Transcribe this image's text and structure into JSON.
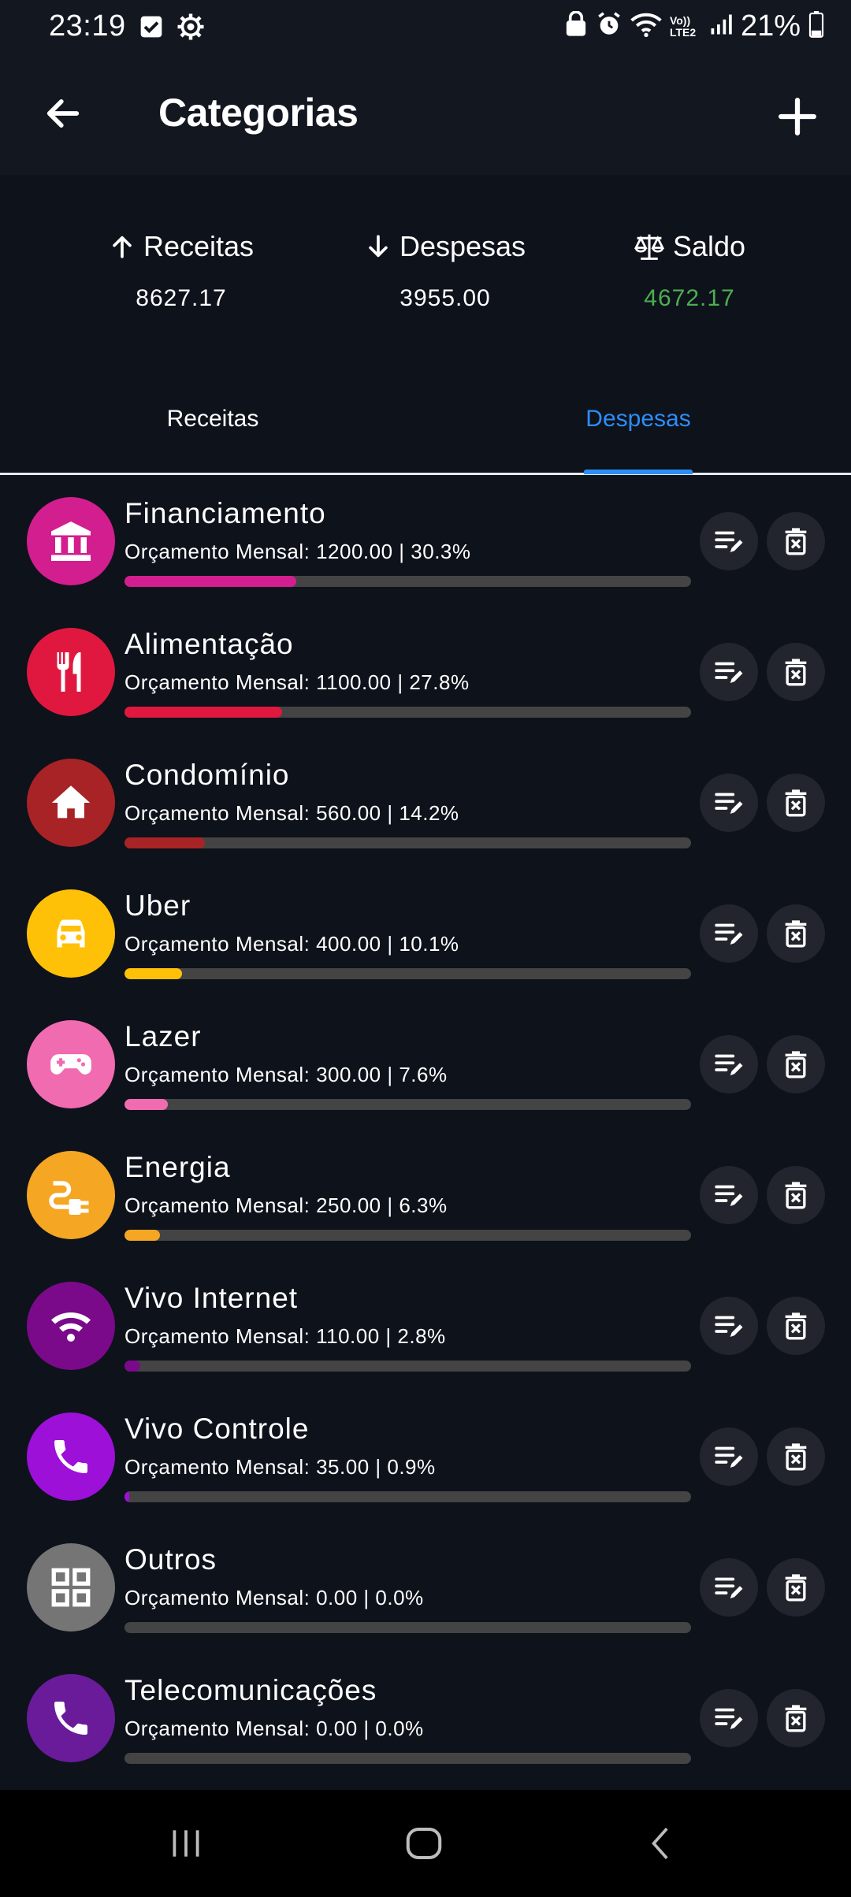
{
  "status_bar": {
    "time": "23:19",
    "battery": "21%",
    "icons_left": [
      "checkbox-icon",
      "gear-icon"
    ],
    "icons_right": [
      "lock-icon",
      "alarm-icon",
      "wifi-icon",
      "volte-icon",
      "signal-icon",
      "battery-icon"
    ],
    "network_label": "Vo)) LTE2"
  },
  "app_bar": {
    "title": "Categorias",
    "back_icon": "arrow-left-icon",
    "add_icon": "plus-icon"
  },
  "summary": {
    "income": {
      "label": "Receitas",
      "value": "8627.17",
      "icon": "arrow-up-icon"
    },
    "expense": {
      "label": "Despesas",
      "value": "3955.00",
      "icon": "arrow-down-icon"
    },
    "balance": {
      "label": "Saldo",
      "value": "4672.17",
      "icon": "scale-icon",
      "color": "#4caf50"
    }
  },
  "tabs": [
    {
      "label": "Receitas",
      "active": false
    },
    {
      "label": "Despesas",
      "active": true
    }
  ],
  "colors": {
    "accent": "#2e8df6",
    "track": "#444444",
    "positive": "#4caf50"
  },
  "categories": [
    {
      "name": "Financiamento",
      "budget": "Orçamento Mensal: 1200.00 | 30.3%",
      "percent": 30.3,
      "color": "#d31e8f",
      "icon": "bank-icon"
    },
    {
      "name": "Alimentação",
      "budget": "Orçamento Mensal: 1100.00 | 27.8%",
      "percent": 27.8,
      "color": "#e0183f",
      "icon": "cutlery-icon"
    },
    {
      "name": "Condomínio",
      "budget": "Orçamento Mensal: 560.00 | 14.2%",
      "percent": 14.2,
      "color": "#a82325",
      "icon": "home-icon"
    },
    {
      "name": "Uber",
      "budget": "Orçamento Mensal: 400.00 | 10.1%",
      "percent": 10.1,
      "color": "#ffc107",
      "icon": "car-icon"
    },
    {
      "name": "Lazer",
      "budget": "Orçamento Mensal: 300.00 | 7.6%",
      "percent": 7.6,
      "color": "#f06bb0",
      "icon": "gamepad-icon"
    },
    {
      "name": "Energia",
      "budget": "Orçamento Mensal: 250.00 | 6.3%",
      "percent": 6.3,
      "color": "#f5a623",
      "icon": "plug-icon"
    },
    {
      "name": "Vivo Internet",
      "budget": "Orçamento Mensal: 110.00 | 2.8%",
      "percent": 2.8,
      "color": "#7a0a8a",
      "icon": "wifi-icon"
    },
    {
      "name": "Vivo Controle",
      "budget": "Orçamento Mensal: 35.00 | 0.9%",
      "percent": 0.9,
      "color": "#9c10d8",
      "icon": "phone-icon"
    },
    {
      "name": "Outros",
      "budget": "Orçamento Mensal: 0.00 | 0.0%",
      "percent": 0.0,
      "color": "#757575",
      "icon": "grid-icon"
    },
    {
      "name": "Telecomunicações",
      "budget": "Orçamento Mensal: 0.00 | 0.0%",
      "percent": 0.0,
      "color": "#6a1b9a",
      "icon": "phone-icon"
    }
  ],
  "row_actions": {
    "edit_icon": "edit-note-icon",
    "delete_icon": "delete-box-icon"
  },
  "nav_bar": {
    "recents_icon": "recents-icon",
    "home_icon": "home-circle-icon",
    "back_icon": "back-chevron-icon"
  }
}
